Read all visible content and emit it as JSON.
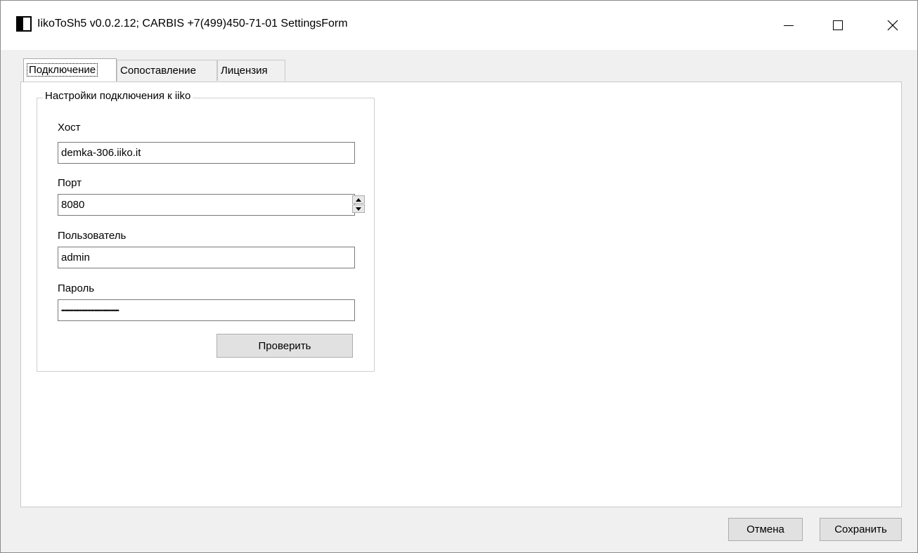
{
  "window": {
    "title": "IikoToSh5 v0.0.2.12;  CARBIS +7(499)450-71-01 SettingsForm",
    "minimize_glyph": "—",
    "maximize_glyph": "☐",
    "close_glyph": "✕"
  },
  "tabs": [
    {
      "label": "Подключение",
      "active": true
    },
    {
      "label": "Сопоставление",
      "active": false
    },
    {
      "label": "Лицензия",
      "active": false
    }
  ],
  "connection": {
    "group_title": "Настройки подключения к iiko",
    "host": {
      "label": "Хост",
      "value": "demka-306.iiko.it"
    },
    "port": {
      "label": "Порт",
      "value": "8080"
    },
    "user": {
      "label": "Пользователь",
      "value": "admin"
    },
    "password": {
      "label": "Пароль",
      "value": "••••••••••••••••••••••••••••••••••••••"
    },
    "check_button": "Проверить"
  },
  "footer": {
    "cancel_button": "Отмена",
    "save_button": "Сохранить"
  },
  "icons": {
    "app": "app-icon",
    "spin_up": "spin-up-icon",
    "spin_down": "spin-down-icon"
  },
  "colors": {
    "panel_bg": "#ffffff",
    "window_bg": "#f0f0f0",
    "button_bg": "#e1e1e1"
  }
}
